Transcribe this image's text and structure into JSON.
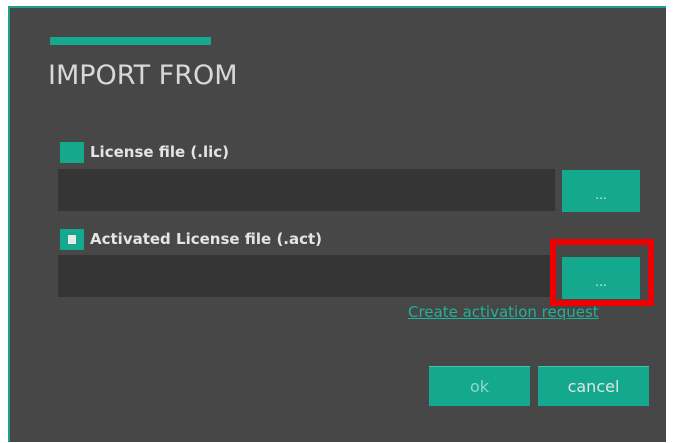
{
  "dialog": {
    "title": "IMPORT FROM"
  },
  "license_file": {
    "checkbox_checked": false,
    "label": "License file (.lic)",
    "value": "",
    "browse_label": "..."
  },
  "activated_file": {
    "checkbox_checked": true,
    "label": "Activated License file (.act)",
    "value": "",
    "browse_label": "..."
  },
  "create_request_link": "Create activation request",
  "buttons": {
    "ok": "ok",
    "cancel": "cancel"
  },
  "colors": {
    "accent": "#14a98f",
    "background": "#474747",
    "field": "#353535",
    "highlight": "#ee0000"
  }
}
